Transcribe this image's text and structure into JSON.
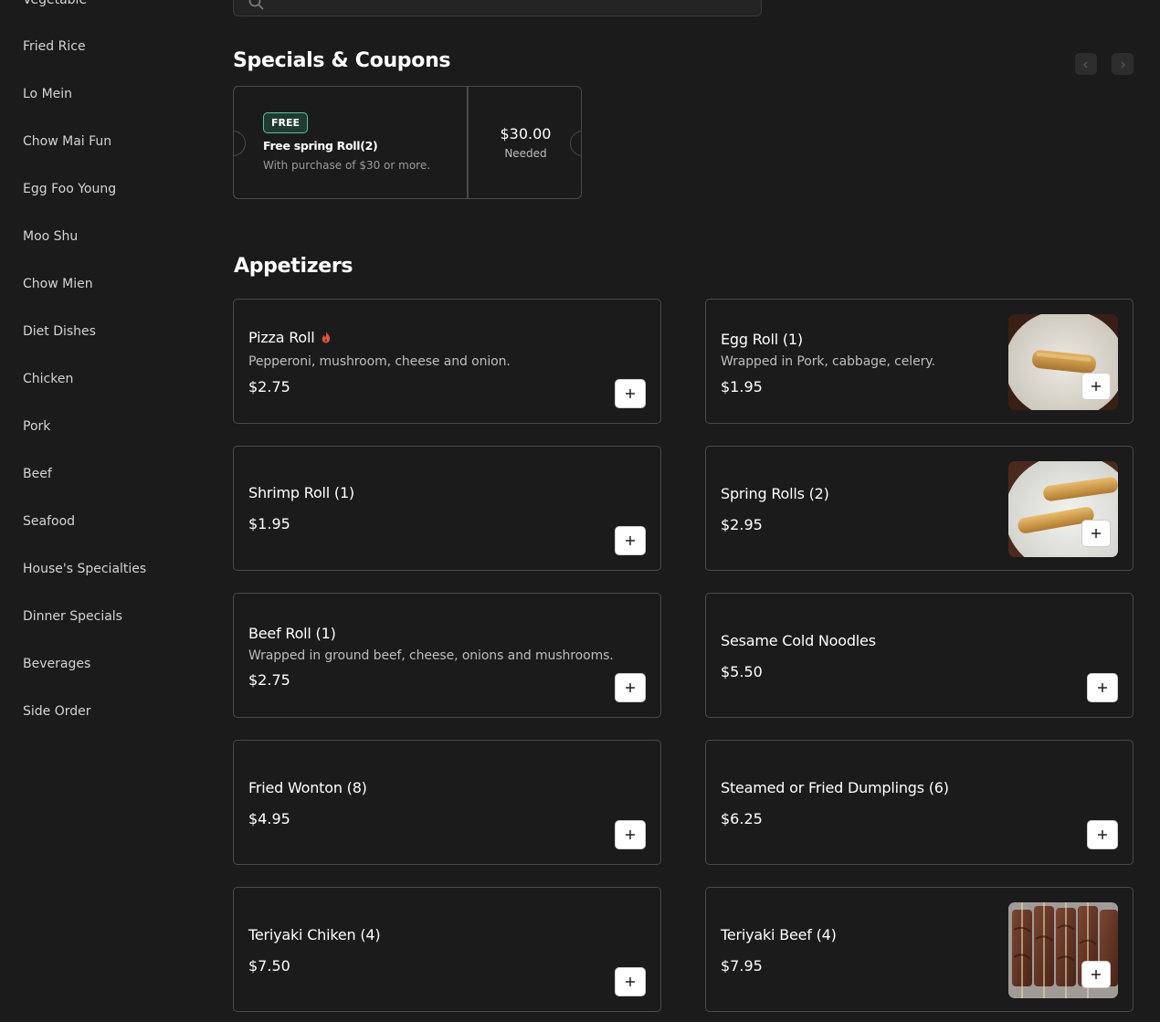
{
  "sidebar": {
    "items": [
      {
        "label": "Vegetable"
      },
      {
        "label": "Fried Rice"
      },
      {
        "label": "Lo Mein"
      },
      {
        "label": "Chow Mai Fun"
      },
      {
        "label": "Egg Foo Young"
      },
      {
        "label": "Moo Shu"
      },
      {
        "label": "Chow Mien"
      },
      {
        "label": "Diet Dishes"
      },
      {
        "label": "Chicken"
      },
      {
        "label": "Pork"
      },
      {
        "label": "Beef"
      },
      {
        "label": "Seafood"
      },
      {
        "label": "House's Specialties"
      },
      {
        "label": "Dinner Specials"
      },
      {
        "label": "Beverages"
      },
      {
        "label": "Side Order"
      }
    ]
  },
  "search": {
    "placeholder": "",
    "icon": "search-icon"
  },
  "specials": {
    "title": "Specials & Coupons",
    "coupon": {
      "badge": "FREE",
      "title": "Free spring Roll(2)",
      "description": "With purchase of $30 or more.",
      "amount": "$30.00",
      "amount_label": "Needed"
    }
  },
  "appetizers": {
    "title": "Appetizers",
    "items": [
      {
        "name": "Pizza Roll",
        "description": "Pepperoni, mushroom, cheese and onion.",
        "price": "$2.75",
        "spicy": true
      },
      {
        "name": "Egg Roll (1)",
        "description": "Wrapped in Pork, cabbage, celery.",
        "price": "$1.95",
        "image": "egg-roll-photo"
      },
      {
        "name": "Shrimp Roll (1)",
        "description": "",
        "price": "$1.95"
      },
      {
        "name": "Spring Rolls (2)",
        "description": "",
        "price": "$2.95",
        "image": "spring-rolls-photo"
      },
      {
        "name": "Beef Roll (1)",
        "description": "Wrapped in ground beef, cheese, onions and mushrooms.",
        "price": "$2.75"
      },
      {
        "name": "Sesame Cold Noodles",
        "description": "",
        "price": "$5.50"
      },
      {
        "name": "Fried Wonton (8)",
        "description": "",
        "price": "$4.95"
      },
      {
        "name": "Steamed or Fried Dumplings (6)",
        "description": "",
        "price": "$6.25"
      },
      {
        "name": "Teriyaki Chiken (4)",
        "description": "",
        "price": "$7.50"
      },
      {
        "name": "Teriyaki Beef (4)",
        "description": "",
        "price": "$7.95",
        "image": "teriyaki-beef-photo"
      }
    ]
  },
  "colors": {
    "background": "#1c1b1c",
    "card_border": "#4a4a4a",
    "badge_border": "#5fbf9c",
    "spicy": "#e0523f"
  }
}
